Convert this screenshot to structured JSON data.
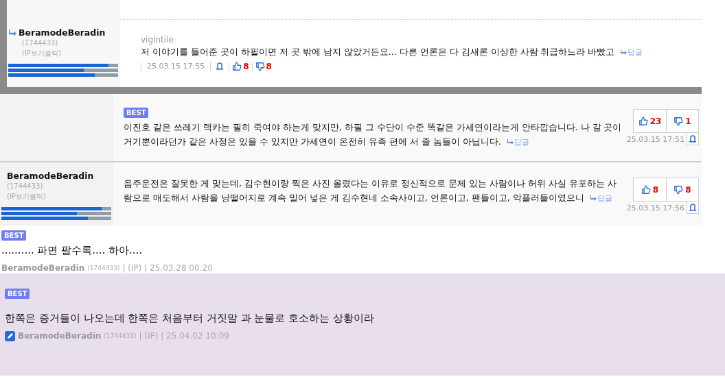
{
  "reply_comment": {
    "author": {
      "name": "BeramodeBeradin",
      "id": "(1744433)",
      "ip": "(IP보기클릭)",
      "bars": [
        {
          "level": 0.91
        },
        {
          "level": 0.69
        },
        {
          "level": 0.79
        }
      ]
    },
    "nickname": "vigintile",
    "text": "저 이야기를 들어준 곳이 하필이면 저 곳 밖에 남지 않았거든요... 다른 언론은 다 김새론 이상한 사람 취급하느라 바빴고",
    "reply_label": "답글",
    "time": "25.03.15 17:55",
    "up": "8",
    "down": "8"
  },
  "comments": [
    {
      "badge": "BEST",
      "text": "이진호 같은 쓰레기 렉카는 필히 죽여야 하는게 맞지만, 하필 그 수단이 수준 똑같은 가세연이라는게 안타깝습니다. 나 갈 곳이 거기뿐이라던가 같은 사정은 있을 수 있지만 가세연이 온전히 유족 편에 서 줄 놈들이 아닙니다.",
      "reply_label": "답글",
      "up": "23",
      "down": "1",
      "time": "25.03.15 17:51"
    },
    {
      "author": {
        "name": "BeramodeBeradin",
        "id": "(1744433)",
        "ip": "(IP보기클릭)",
        "bars": [
          {
            "level": 0.91
          },
          {
            "level": 0.69
          },
          {
            "level": 0.79
          }
        ]
      },
      "text": "음주운전은 잘못한 게 맞는데, 김수현이랑 찍은 사진 올렸다는 이유로 정신적으로 문제 있는 사람이나 허위 사실 유포하는 사람으로 매도해서 사람을 낭떨어지로 계속 밀어 넣은 게 김수현네 소속사이고, 언론이고, 팬들이고, 악플러들이였으니",
      "reply_label": "답글",
      "up": "8",
      "down": "8",
      "time": "25.03.15 17:56"
    }
  ],
  "best_comments": [
    {
      "badge": "BEST",
      "highlighted": false,
      "author_icon": false,
      "text": ".......... 파면 팔수록.... 하아....",
      "author": "BeramodeBeradin",
      "id": "(1744433)",
      "meta": "| (IP) | 25.03.28 00:20"
    },
    {
      "badge": "BEST",
      "highlighted": true,
      "author_icon": true,
      "text": "한쪽은 증거들이 나오는데 한쪽은 처음부터 거짓말 과 눈물로 호소하는 상황이라",
      "author": "BeramodeBeradin",
      "id": "(1744433)",
      "meta": "| (IP) | 25.04.02 10:09"
    }
  ]
}
